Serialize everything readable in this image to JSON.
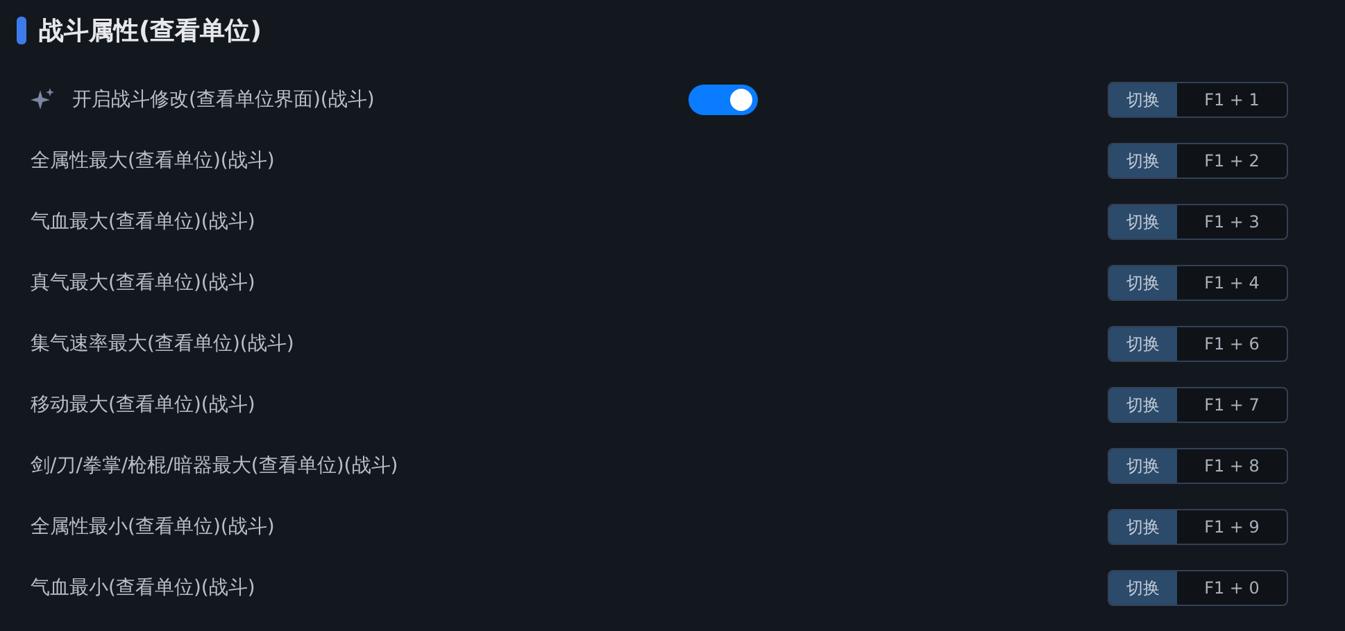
{
  "section": {
    "title": "战斗属性(查看单位)"
  },
  "rows": [
    {
      "kind": "toggle",
      "label": "开启战斗修改(查看单位界面)(战斗)",
      "on": true,
      "action": "切换",
      "hotkey": "F1 + 1"
    },
    {
      "kind": "action",
      "label": "全属性最大(查看单位)(战斗)",
      "action": "切换",
      "hotkey": "F1 + 2"
    },
    {
      "kind": "action",
      "label": "气血最大(查看单位)(战斗)",
      "action": "切换",
      "hotkey": "F1 + 3"
    },
    {
      "kind": "action",
      "label": "真气最大(查看单位)(战斗)",
      "action": "切换",
      "hotkey": "F1 + 4"
    },
    {
      "kind": "action",
      "label": "集气速率最大(查看单位)(战斗)",
      "action": "切换",
      "hotkey": "F1 + 6"
    },
    {
      "kind": "action",
      "label": "移动最大(查看单位)(战斗)",
      "action": "切换",
      "hotkey": "F1 + 7"
    },
    {
      "kind": "action",
      "label": "剑/刀/拳掌/枪棍/暗器最大(查看单位)(战斗)",
      "action": "切换",
      "hotkey": "F1 + 8"
    },
    {
      "kind": "action",
      "label": "全属性最小(查看单位)(战斗)",
      "action": "切换",
      "hotkey": "F1 + 9"
    },
    {
      "kind": "action",
      "label": "气血最小(查看单位)(战斗)",
      "action": "切换",
      "hotkey": "F1 + 0"
    }
  ]
}
